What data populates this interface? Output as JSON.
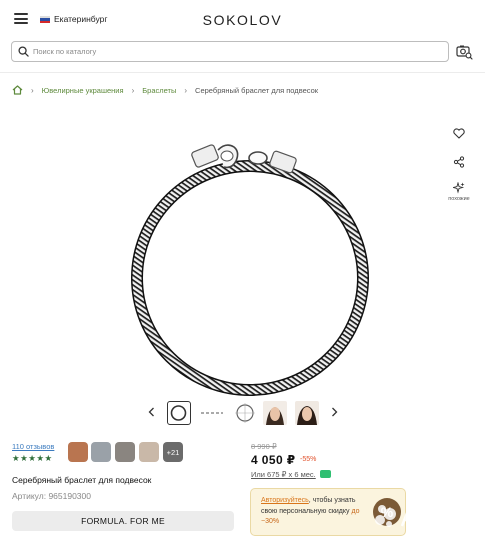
{
  "header": {
    "city": "Екатеринбург",
    "logo": "SOKOLOV",
    "icons": [
      "menu-icon",
      "flag-icon"
    ]
  },
  "search": {
    "placeholder": "Поиск по каталогу",
    "value": "",
    "icons": [
      "search-icon",
      "photo-search-icon"
    ]
  },
  "breadcrumbs": {
    "items": [
      "Ювелирные украшения",
      "Браслеты",
      "Серебряный браслет для подвесок"
    ]
  },
  "actions": {
    "similar_label": "похожие",
    "icons": [
      "heart-icon",
      "share-icon",
      "sparkle-icon"
    ]
  },
  "gallery": {
    "active_index": 0
  },
  "reviews": {
    "link": "110 отзывов",
    "rating_stars": 5,
    "stars_text": "★★★★★",
    "more_photos": "+21"
  },
  "product": {
    "title": "Серебряный браслет для подвесок",
    "article_label": "Артикул:",
    "article": "965190300",
    "formula_button": "FORMULA. FOR ME"
  },
  "price": {
    "old": "8 990 ₽",
    "current": "4 050 ₽",
    "discount": "-55%",
    "installment": "Или 675 ₽ x 6 мес."
  },
  "promo": {
    "link": "Авторизуйтесь",
    "text": ", чтобы узнать свою персональную скидку ",
    "upto": "до",
    "value": "−30%",
    "badge": "%"
  },
  "colors": {
    "accent_green": "#5e8a3c",
    "stars": "#2f6e3a",
    "discount": "#e0502a",
    "promo_bg": "#fbf4de",
    "promo_badge": "#7b5a36"
  }
}
